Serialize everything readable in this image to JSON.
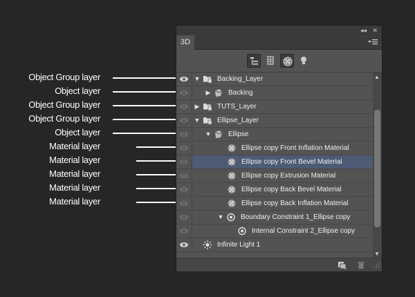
{
  "annotations": [
    {
      "label": "Object Group layer"
    },
    {
      "label": "Object layer"
    },
    {
      "label": "Object Group layer"
    },
    {
      "label": "Object Group layer"
    },
    {
      "label": "Object layer"
    },
    {
      "label": "Material layer"
    },
    {
      "label": "Material layer"
    },
    {
      "label": "Material layer"
    },
    {
      "label": "Material layer"
    },
    {
      "label": "Material layer"
    }
  ],
  "panel": {
    "tab_label": "3D",
    "collapse_glyph": "◂◂",
    "close_glyph": "✕",
    "toolbar": [
      "scene-filter",
      "meshes-filter",
      "materials-filter",
      "lights-filter"
    ],
    "layers": [
      {
        "label": "Backing_Layer",
        "type": "group",
        "expanded": true
      },
      {
        "label": "Backing",
        "type": "object",
        "expanded": false
      },
      {
        "label": "TUTS_Layer",
        "type": "group",
        "expanded": false
      },
      {
        "label": "Ellipse_Layer",
        "type": "group",
        "expanded": true
      },
      {
        "label": "Ellipse",
        "type": "object",
        "expanded": true
      },
      {
        "label": "Ellipse copy Front Inflation Material",
        "type": "material"
      },
      {
        "label": "Ellipse copy Front Bevel Material",
        "type": "material",
        "selected": true
      },
      {
        "label": "Ellipse copy Extrusion Material",
        "type": "material"
      },
      {
        "label": "Ellipse copy Back Bevel Material",
        "type": "material"
      },
      {
        "label": "Ellipse copy Back Inflation Material",
        "type": "material"
      },
      {
        "label": "Boundary Constraint 1_Ellipse copy",
        "type": "constraint",
        "expanded": true
      },
      {
        "label": "Internal Constraint 2_Ellipse copy",
        "type": "constraint"
      },
      {
        "label": "Infinite Light 1",
        "type": "light"
      }
    ]
  },
  "colors": {
    "background": "#262626",
    "panel": "#535353",
    "selected_row": "#4d5b74",
    "annotation_text": "#ffffff"
  }
}
